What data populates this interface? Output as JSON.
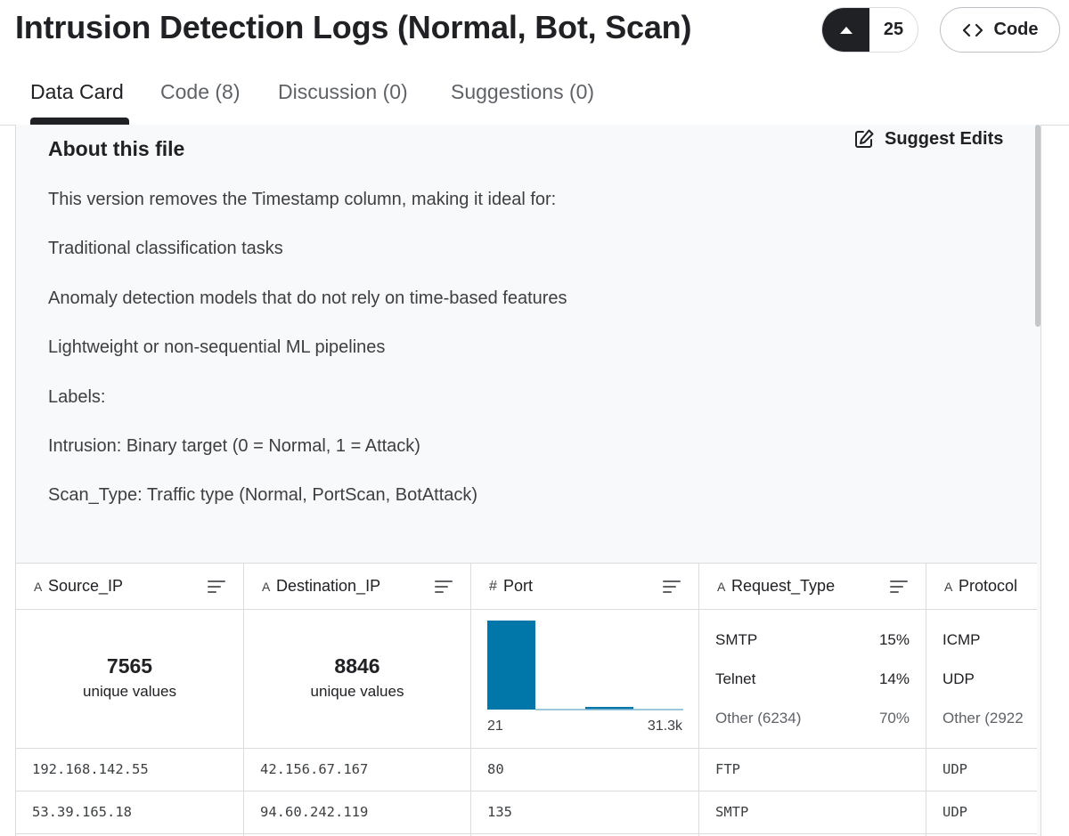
{
  "header": {
    "title": "Intrusion Detection Logs (Normal, Bot, Scan)",
    "vote_count": "25",
    "code_button_label": "Code"
  },
  "tabs": [
    {
      "label": "Data Card",
      "active": true
    },
    {
      "label": "Code (8)",
      "active": false
    },
    {
      "label": "Discussion (0)",
      "active": false
    },
    {
      "label": "Suggestions (0)",
      "active": false
    }
  ],
  "about": {
    "title": "About this file",
    "suggest_edits_label": "Suggest Edits",
    "paragraphs": [
      "This version removes the Timestamp column, making it ideal for:",
      "Traditional classification tasks",
      "Anomaly detection models that do not rely on time-based features",
      "Lightweight or non-sequential ML pipelines",
      "Labels:",
      "Intrusion: Binary target (0 = Normal, 1 = Attack)",
      "Scan_Type: Traffic type (Normal, PortScan, BotAttack)"
    ]
  },
  "table": {
    "columns": [
      {
        "type_icon": "A",
        "name": "Source_IP"
      },
      {
        "type_icon": "A",
        "name": "Destination_IP"
      },
      {
        "type_icon": "#",
        "name": "Port"
      },
      {
        "type_icon": "A",
        "name": "Request_Type"
      },
      {
        "type_icon": "A",
        "name": "Protocol"
      }
    ],
    "summaries": {
      "source_ip": {
        "count": "7565",
        "label": "unique values"
      },
      "destination_ip": {
        "count": "8846",
        "label": "unique values"
      },
      "port": {
        "min_label": "21",
        "max_label": "31.3k",
        "bar_color": "#0077a8"
      },
      "request_type": [
        {
          "label": "SMTP",
          "pct": "15%"
        },
        {
          "label": "Telnet",
          "pct": "14%"
        },
        {
          "label": "Other (6234)",
          "pct": "70%"
        }
      ],
      "protocol": [
        {
          "label": "ICMP"
        },
        {
          "label": "UDP"
        },
        {
          "label": "Other (2922"
        }
      ]
    },
    "rows": [
      [
        "192.168.142.55",
        "42.156.67.167",
        "80",
        "FTP",
        "UDP"
      ],
      [
        "53.39.165.18",
        "94.60.242.119",
        "135",
        "SMTP",
        "UDP"
      ]
    ]
  },
  "colors": {
    "accent_dark": "#202124",
    "histogram_bar": "#0077a8",
    "panel_bg": "#f8f9fa"
  }
}
